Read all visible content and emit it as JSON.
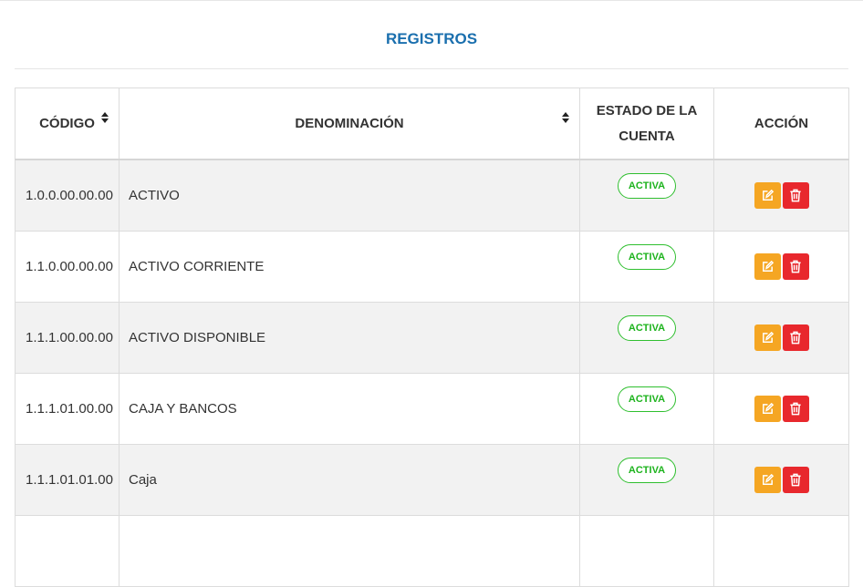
{
  "panel": {
    "title": "REGISTROS"
  },
  "table": {
    "headers": {
      "codigo": "CÓDIGO",
      "denominacion": "DENOMINACIÓN",
      "estado": "ESTADO DE LA CUENTA",
      "accion": "ACCIÓN"
    },
    "rows": [
      {
        "codigo": "1.0.0.00.00.00",
        "denominacion": "ACTIVO",
        "estado": "ACTIVA"
      },
      {
        "codigo": "1.1.0.00.00.00",
        "denominacion": "ACTIVO CORRIENTE",
        "estado": "ACTIVA"
      },
      {
        "codigo": "1.1.1.00.00.00",
        "denominacion": "ACTIVO DISPONIBLE",
        "estado": "ACTIVA"
      },
      {
        "codigo": "1.1.1.01.00.00",
        "denominacion": "CAJA Y BANCOS",
        "estado": "ACTIVA"
      },
      {
        "codigo": "1.1.1.01.01.00",
        "denominacion": "Caja",
        "estado": "ACTIVA"
      },
      {
        "codigo": "",
        "denominacion": "",
        "estado": ""
      }
    ]
  },
  "icons": {
    "edit": "edit-icon",
    "delete": "trash-icon",
    "sort": "sort-icon"
  },
  "colors": {
    "title": "#1a6fae",
    "edit_button": "#f5a623",
    "delete_button": "#e8282d",
    "badge": "#1db31d"
  }
}
